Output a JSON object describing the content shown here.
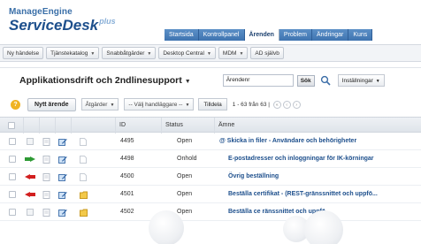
{
  "app": {
    "logo_top": "ManageEngine",
    "logo_main": "ServiceDesk",
    "logo_plus": "plus"
  },
  "tabs": [
    {
      "label": "Startsida",
      "active": false
    },
    {
      "label": "Kontrollpanel",
      "active": false
    },
    {
      "label": "Ärenden",
      "active": true
    },
    {
      "label": "Problem",
      "active": false
    },
    {
      "label": "Ändringar",
      "active": false
    },
    {
      "label": "Kuns",
      "active": false
    }
  ],
  "toolbar": {
    "items": [
      {
        "label": "Ny händelse",
        "dropdown": false
      },
      {
        "label": "Tjänstekatalog",
        "dropdown": true
      },
      {
        "label": "Snabbåtgärder",
        "dropdown": true
      },
      {
        "label": "Desktop Central",
        "dropdown": true
      },
      {
        "label": "MDM",
        "dropdown": true
      },
      {
        "label": "AD självb",
        "dropdown": false
      }
    ]
  },
  "panel": {
    "title": "Applikationsdrift och 2ndlinesupport",
    "search_value": "Ärendenr",
    "search_button": "Sök",
    "settings_label": "Inställningar"
  },
  "actions": {
    "help": "?",
    "new_request": "Nytt ärende",
    "actions_select": "Åtgärder",
    "technician_select": "-- Välj handläggare --",
    "assign_button": "Tilldela",
    "pager_text": "1 - 63 från 63 |"
  },
  "grid": {
    "columns": [
      "",
      "",
      "",
      "",
      "",
      "ID",
      "Status",
      "Ämne"
    ],
    "rows": [
      {
        "flag": "none",
        "id": "4495",
        "status": "Open",
        "subject": "Skicka in filer - Användare och behörigheter",
        "attachment": true
      },
      {
        "flag": "green",
        "id": "4498",
        "status": "Onhold",
        "subject": "E-postadresser och inloggningar för IK-körningar",
        "attachment": false
      },
      {
        "flag": "red",
        "id": "4500",
        "status": "Open",
        "subject": "Övrig beställning",
        "attachment": false
      },
      {
        "flag": "red",
        "id": "4501",
        "status": "Open",
        "subject": "Beställa certifikat - (REST-gränssnittet och uppfö...",
        "attachment": false
      },
      {
        "flag": "none",
        "id": "4502",
        "status": "Open",
        "subject": "Beställa ce                ränssnittet och uppfö...",
        "attachment": false
      }
    ]
  },
  "colors": {
    "brand": "#1d4f8c",
    "tab_bg": "#4a80bd",
    "link": "#1d4f8c",
    "flag_red": "#d21f1f",
    "flag_green": "#2e9a34"
  }
}
